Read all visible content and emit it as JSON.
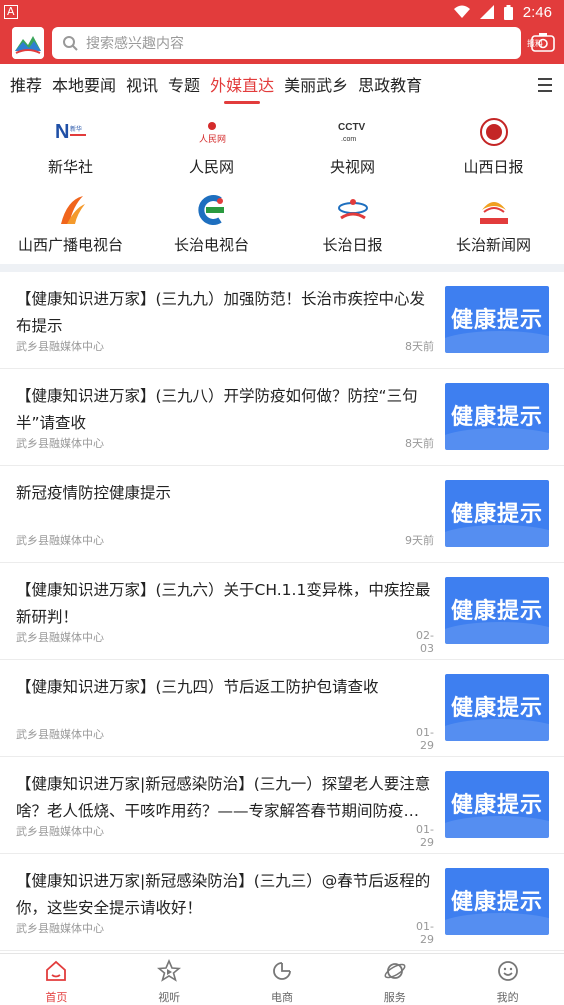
{
  "status": {
    "indicator": "A",
    "time": "2:46"
  },
  "search": {
    "placeholder": "搜索感兴趣内容"
  },
  "header": {
    "shot_label": "报料"
  },
  "tabs": [
    {
      "label": "推荐"
    },
    {
      "label": "本地要闻"
    },
    {
      "label": "视讯"
    },
    {
      "label": "专题"
    },
    {
      "label": "外媒直达",
      "active": true
    },
    {
      "label": "美丽武乡"
    },
    {
      "label": "思政教育"
    }
  ],
  "media": [
    {
      "name": "新华社",
      "icon": "xinhua-logo-icon"
    },
    {
      "name": "人民网",
      "icon": "renmin-logo-icon"
    },
    {
      "name": "央视网",
      "icon": "cctv-logo-icon"
    },
    {
      "name": "山西日报",
      "icon": "shanxi-daily-logo-icon"
    },
    {
      "name": "山西广播电视台",
      "icon": "shanxi-tv-logo-icon"
    },
    {
      "name": "长治电视台",
      "icon": "changzhi-tv-logo-icon"
    },
    {
      "name": "长治日报",
      "icon": "changzhi-daily-logo-icon"
    },
    {
      "name": "长治新闻网",
      "icon": "changzhi-news-logo-icon"
    }
  ],
  "news": [
    {
      "title": "【健康知识进万家】(三九九）加强防范！长治市疾控中心发布提示",
      "source": "武乡县融媒体中心",
      "time": "8天前",
      "thumb_text": "健康提示"
    },
    {
      "title": "【健康知识进万家】(三九八）开学防疫如何做？防控“三句半”请查收",
      "source": "武乡县融媒体中心",
      "time": "8天前",
      "thumb_text": "健康提示"
    },
    {
      "title": "新冠疫情防控健康提示",
      "source": "武乡县融媒体中心",
      "time": "9天前",
      "thumb_text": "健康提示"
    },
    {
      "title": "【健康知识进万家】(三九六）关于CH.1.1变异株，中疾控最新研判！",
      "source": "武乡县融媒体中心",
      "time": "02-03",
      "thumb_text": "健康提示"
    },
    {
      "title": "【健康知识进万家】(三九四）节后返工防护包请查收",
      "source": "武乡县融媒体中心",
      "time": "01-29",
      "thumb_text": "健康提示"
    },
    {
      "title": "【健康知识进万家|新冠感染防治】(三九一）探望老人要注意啥？老人低烧、干咳咋用药？——专家解答春节期间防疫热…",
      "source": "武乡县融媒体中心",
      "time": "01-29",
      "thumb_text": "健康提示"
    },
    {
      "title": "【健康知识进万家|新冠感染防治】(三九三）@春节后返程的你，这些安全提示请收好！",
      "source": "武乡县融媒体中心",
      "time": "01-29",
      "thumb_text": "健康提示"
    }
  ],
  "bottom_nav": [
    {
      "label": "首页",
      "icon": "home-icon",
      "active": true
    },
    {
      "label": "视听",
      "icon": "play-icon"
    },
    {
      "label": "电商",
      "icon": "shop-icon"
    },
    {
      "label": "服务",
      "icon": "planet-icon"
    },
    {
      "label": "我的",
      "icon": "smile-icon"
    }
  ],
  "colors": {
    "brand": "#e23c3c",
    "thumb": "#3e7ff0"
  }
}
